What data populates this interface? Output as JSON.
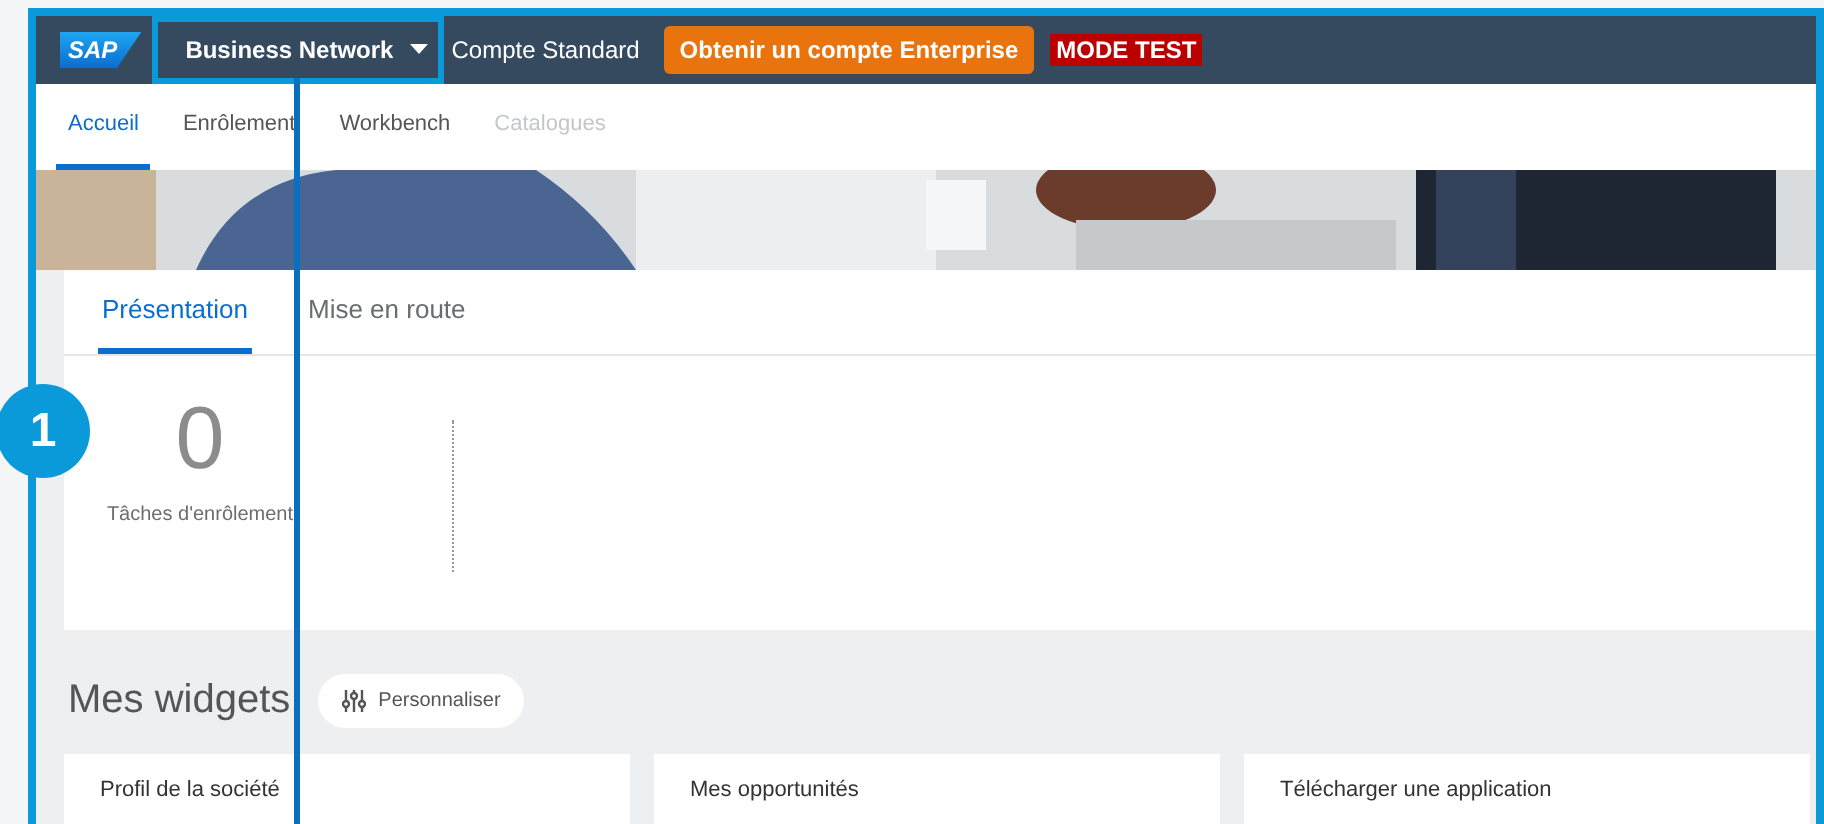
{
  "shell": {
    "logo": "SAP",
    "product": "Business Network",
    "account": "Compte Standard",
    "upgrade_button": "Obtenir un compte Enterprise",
    "test_badge": "MODE TEST"
  },
  "nav_tabs": [
    {
      "label": "Accueil",
      "selected": true,
      "disabled": false
    },
    {
      "label": "Enrôlement",
      "selected": false,
      "disabled": false
    },
    {
      "label": "Workbench",
      "selected": false,
      "disabled": false
    },
    {
      "label": "Catalogues",
      "selected": false,
      "disabled": true
    }
  ],
  "overview": {
    "tabs": [
      {
        "label": "Présentation",
        "selected": true
      },
      {
        "label": "Mise en route",
        "selected": false
      }
    ],
    "tiles": [
      {
        "value": "0",
        "label": "Tâches d'enrôlement"
      }
    ]
  },
  "widgets": {
    "title": "Mes widgets",
    "customize_button": "Personnaliser",
    "cards": [
      {
        "title": "Profil de la société"
      },
      {
        "title": "Mes opportunités"
      },
      {
        "title": "Télécharger une application"
      }
    ]
  },
  "annotation": {
    "step": "1"
  }
}
